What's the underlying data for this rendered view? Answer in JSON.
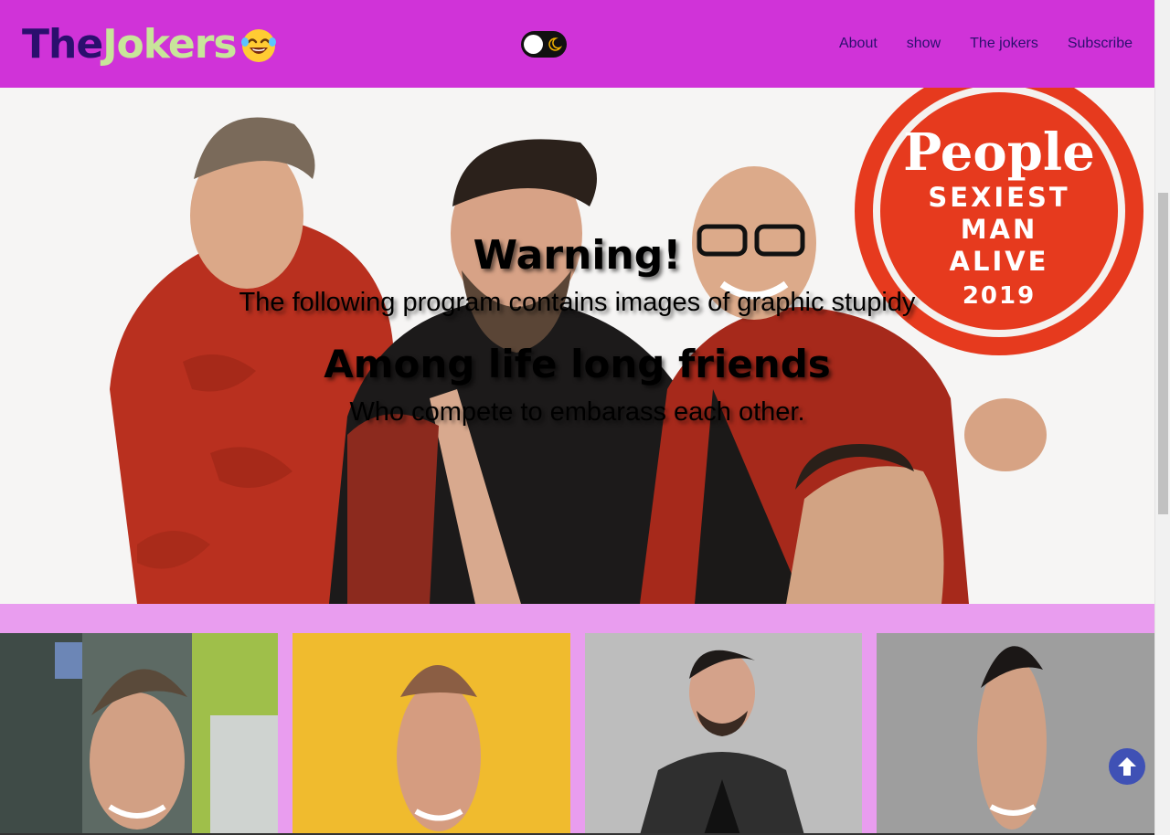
{
  "navbar": {
    "logo_part1": "The",
    "logo_part2": "Jokers",
    "logo_emoji": "laughing-face-icon",
    "theme_toggle": {
      "state": "light",
      "icon": "moon-icon"
    },
    "links": [
      {
        "label": "About"
      },
      {
        "label": "show"
      },
      {
        "label": "The jokers"
      },
      {
        "label": "Subscribe"
      }
    ]
  },
  "hero": {
    "title": "Warning!",
    "subtitle": "The following program contains images of graphic stupidy",
    "heading2": "Among life long friends",
    "subheading2": "Who compete to embarass each other.",
    "badge": {
      "brand": "People",
      "line1": "SEXIEST",
      "line2": "MAN",
      "line3": "ALIVE",
      "year": "2019"
    }
  },
  "cards": [
    {
      "name": "joker-card-1",
      "image": "portrait-photo"
    },
    {
      "name": "joker-card-2",
      "image": "portrait-photo"
    },
    {
      "name": "joker-card-3",
      "image": "portrait-photo"
    },
    {
      "name": "joker-card-4",
      "image": "portrait-photo"
    }
  ],
  "colors": {
    "navbar_bg": "#d033d8",
    "page_bg": "#e99def",
    "logo_dark": "#2b0f6e",
    "logo_light": "#c8e59a",
    "to_top_bg": "#3f51b5"
  },
  "back_to_top": {
    "icon": "arrow-up-icon"
  }
}
